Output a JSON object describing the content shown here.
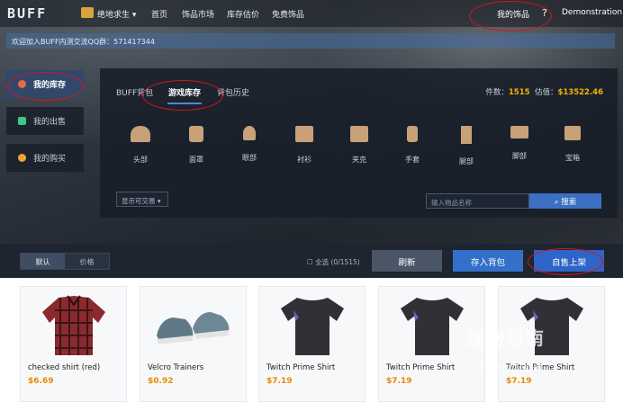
{
  "nav": {
    "logo": "BUFF",
    "game": "绝地求生",
    "links": [
      "首页",
      "饰品市场",
      "库存估价",
      "免费饰品"
    ],
    "my_items": "我的饰品",
    "help": "?",
    "user": "Demonstration"
  },
  "notice": "欢迎加入BUFF内测交流QQ群：571417344",
  "sidebar": {
    "items": [
      {
        "label": "我的库存",
        "icon": "backpack-icon",
        "active": true
      },
      {
        "label": "我的出售",
        "icon": "gem-icon",
        "active": false
      },
      {
        "label": "我的购买",
        "icon": "bag-icon",
        "active": false
      }
    ]
  },
  "tabs": [
    "BUFF背包",
    "游戏库存",
    "背包历史"
  ],
  "stats": {
    "count_label": "件数：",
    "count": "1515",
    "value_label": "估值：",
    "value": "$13522.46"
  },
  "categories": [
    "头部",
    "面罩",
    "眼部",
    "衬衫",
    "夹克",
    "手套",
    "腿部",
    "脚部",
    "宝箱"
  ],
  "filter": {
    "label": "显示可交易"
  },
  "search": {
    "placeholder": "输入物品名称",
    "button": "搜索"
  },
  "toolbar": {
    "sort": [
      "默认",
      "价格"
    ],
    "select_all": "全选 (0/1515)",
    "refresh": "刷新",
    "deposit": "存入背包",
    "sell": "自售上架"
  },
  "items": [
    {
      "name": "checked shirt (red)",
      "price": "$6.69"
    },
    {
      "name": "Velcro Trainers",
      "price": "$0.92"
    },
    {
      "name": "Twitch Prime Shirt",
      "price": "$7.19"
    },
    {
      "name": "Twitch Prime Shirt",
      "price": "$7.19"
    },
    {
      "name": "Twitch Prime Shirt",
      "price": "$7.19"
    }
  ],
  "watermark": {
    "text": "搜狗指南",
    "url": "zhinan.sogou.com"
  },
  "colors": {
    "accent": "#3a6fc4",
    "price": "#e88a00",
    "sell": "#2f64c8",
    "annotation": "#d9141a"
  }
}
